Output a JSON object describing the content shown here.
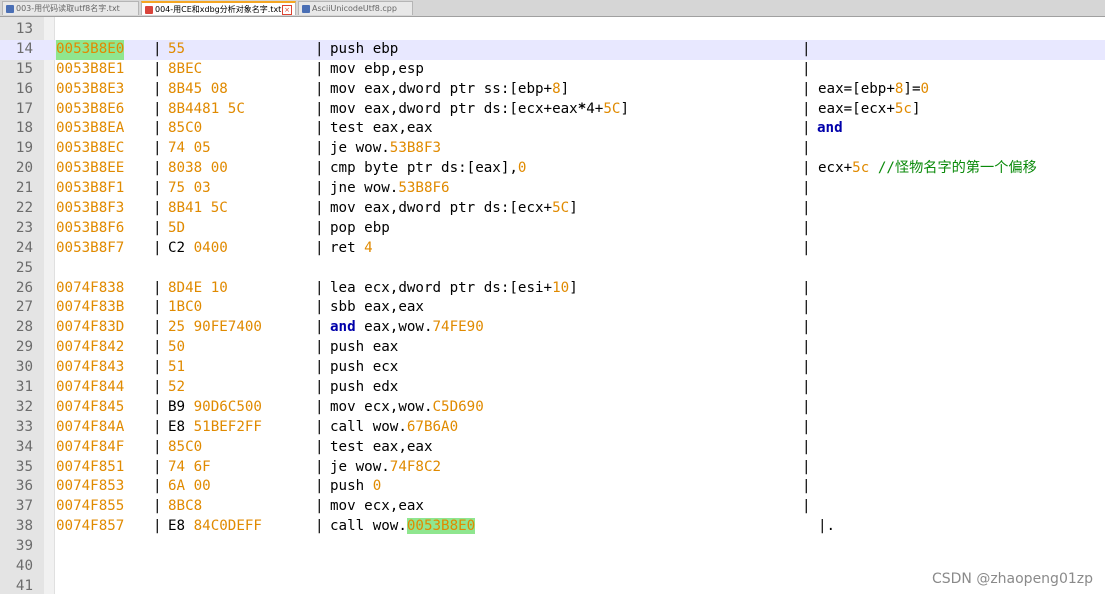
{
  "tabs": [
    {
      "label": "003-用代码读取utf8名字.txt",
      "active": false,
      "icon": "text-file-icon"
    },
    {
      "label": "004-用CE和xdbg分析对象名字.txt",
      "active": true,
      "icon": "text-file-modified-icon"
    },
    {
      "label": "AsciiUnicodeUtf8.cpp",
      "active": false,
      "icon": "cpp-file-icon"
    }
  ],
  "lines": [
    {
      "n": "13"
    },
    {
      "n": "14",
      "addr": "0053B8E0",
      "hex": "55",
      "asm": "push ebp",
      "sep": true
    },
    {
      "n": "15",
      "addr": "0053B8E1",
      "hex": "8BEC",
      "asm": "mov ebp,esp",
      "sep": true
    },
    {
      "n": "16",
      "addr": "0053B8E3",
      "hex": "8B45 08",
      "asm": "mov eax,dword ptr ss:[ebp+8]",
      "sep": true,
      "cmt": "eax=[ebp+8]=0"
    },
    {
      "n": "17",
      "addr": "0053B8E6",
      "hex": "8B4481 5C",
      "asm": "mov eax,dword ptr ds:[ecx+eax*4+5C]",
      "sep": true,
      "cmt": "eax=[ecx+5c]"
    },
    {
      "n": "18",
      "addr": "0053B8EA",
      "hex": "85C0",
      "asm": "test eax,eax",
      "sep": true,
      "cmt": "and"
    },
    {
      "n": "19",
      "addr": "0053B8EC",
      "hex": "74 05",
      "asm": "je wow.53B8F3",
      "sep": true
    },
    {
      "n": "20",
      "addr": "0053B8EE",
      "hex": "8038 00",
      "asm": "cmp byte ptr ds:[eax],0",
      "sep": true,
      "cmt": "ecx+5c //怪物名字的第一个偏移"
    },
    {
      "n": "21",
      "addr": "0053B8F1",
      "hex": "75 03",
      "asm": "jne wow.53B8F6",
      "sep": true
    },
    {
      "n": "22",
      "addr": "0053B8F3",
      "hex": "8B41 5C",
      "asm": "mov eax,dword ptr ds:[ecx+5C]",
      "sep": true
    },
    {
      "n": "23",
      "addr": "0053B8F6",
      "hex": "5D",
      "asm": "pop ebp",
      "sep": true
    },
    {
      "n": "24",
      "addr": "0053B8F7",
      "hex": "C2 0400",
      "asm": "ret 4",
      "sep": true
    },
    {
      "n": "25"
    },
    {
      "n": "26",
      "addr": "0074F838",
      "hex": "8D4E 10",
      "asm": "lea ecx,dword ptr ds:[esi+10]",
      "sep": true
    },
    {
      "n": "27",
      "addr": "0074F83B",
      "hex": "1BC0",
      "asm": "sbb eax,eax",
      "sep": true
    },
    {
      "n": "28",
      "addr": "0074F83D",
      "hex": "25 90FE7400",
      "asm": "and eax,wow.74FE90",
      "sep": true
    },
    {
      "n": "29",
      "addr": "0074F842",
      "hex": "50",
      "asm": "push eax",
      "sep": true
    },
    {
      "n": "30",
      "addr": "0074F843",
      "hex": "51",
      "asm": "push ecx",
      "sep": true
    },
    {
      "n": "31",
      "addr": "0074F844",
      "hex": "52",
      "asm": "push edx",
      "sep": true
    },
    {
      "n": "32",
      "addr": "0074F845",
      "hex": "B9 90D6C500",
      "asm": "mov ecx,wow.C5D690",
      "sep": true
    },
    {
      "n": "33",
      "addr": "0074F84A",
      "hex": "E8 51BEF2FF",
      "asm": "call wow.67B6A0",
      "sep": true
    },
    {
      "n": "34",
      "addr": "0074F84F",
      "hex": "85C0",
      "asm": "test eax,eax",
      "sep": true
    },
    {
      "n": "35",
      "addr": "0074F851",
      "hex": "74 6F",
      "asm": "je wow.74F8C2",
      "sep": true
    },
    {
      "n": "36",
      "addr": "0074F853",
      "hex": "6A 00",
      "asm": "push 0",
      "sep": true
    },
    {
      "n": "37",
      "addr": "0074F855",
      "hex": "8BC8",
      "asm": "mov ecx,eax",
      "sep": true
    },
    {
      "n": "38",
      "addr": "0074F857",
      "hex": "E8 84C0DEFF",
      "asm": "call wow.0053B8E0",
      "sep": true,
      "cmt": "|."
    },
    {
      "n": "39"
    },
    {
      "n": "40"
    },
    {
      "n": "41"
    }
  ],
  "watermark": "CSDN @zhaopeng01zp",
  "colors": {
    "number": "#e08a00",
    "keyword": "#0000aa",
    "comment": "#0a8a0a",
    "selection": "#8fe68f",
    "current_line": "#e8e8ff"
  }
}
